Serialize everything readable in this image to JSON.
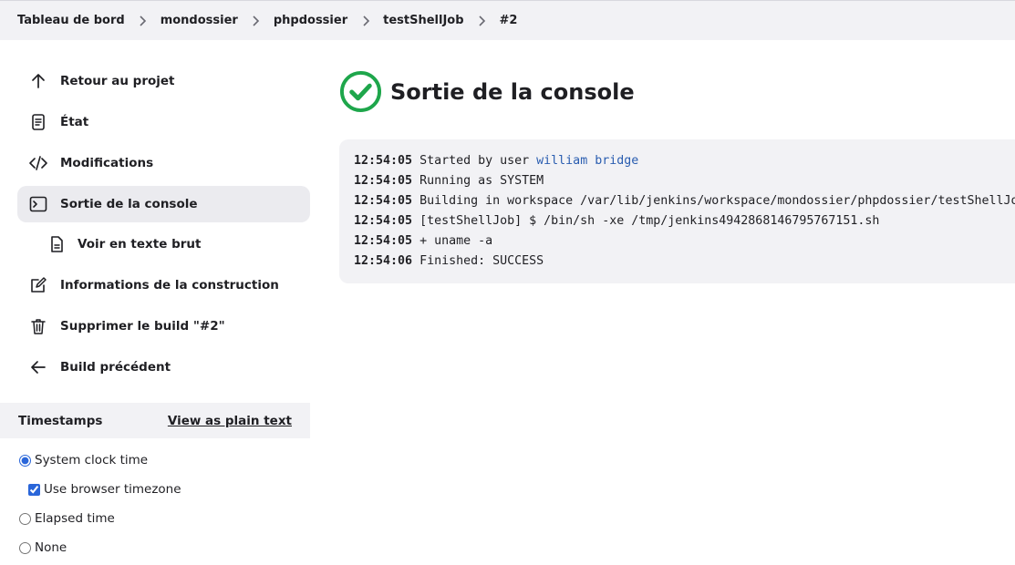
{
  "breadcrumb": [
    "Tableau de bord",
    "mondossier",
    "phpdossier",
    "testShellJob",
    "#2"
  ],
  "sidebar": {
    "back": "Retour au projet",
    "status": "État",
    "changes": "Modifications",
    "console": "Sortie de la console",
    "plain": "Voir en texte brut",
    "info": "Informations de la construction",
    "delete": "Supprimer le build \"#2\"",
    "previous": "Build précédent"
  },
  "timestamps": {
    "title": "Timestamps",
    "link": "View as plain text",
    "system": "System clock time",
    "browser_tz": "Use browser timezone",
    "elapsed": "Elapsed time",
    "none": "None",
    "selected": "system",
    "browser_tz_checked": true
  },
  "main": {
    "title": "Sortie de la console",
    "status_color": "#1ea64b"
  },
  "console": {
    "lines": [
      {
        "ts": "12:54:05",
        "text": "Started by user ",
        "link": "william bridge"
      },
      {
        "ts": "12:54:05",
        "text": "Running as SYSTEM"
      },
      {
        "ts": "12:54:05",
        "text": "Building in workspace /var/lib/jenkins/workspace/mondossier/phpdossier/testShellJob"
      },
      {
        "ts": "12:54:05",
        "text": "[testShellJob] $ /bin/sh -xe /tmp/jenkins4942868146795767151.sh"
      },
      {
        "ts": "12:54:05",
        "text": "+ uname -a"
      },
      {
        "ts": "12:54:06",
        "text": "Finished: SUCCESS"
      }
    ]
  }
}
